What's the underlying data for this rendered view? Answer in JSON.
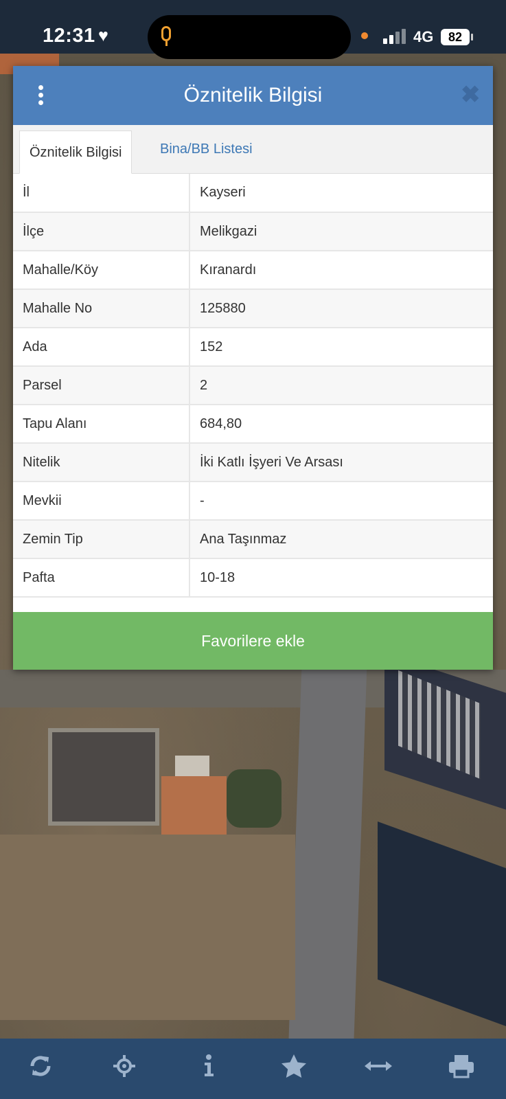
{
  "status_bar": {
    "time": "12:31",
    "network": "4G",
    "battery": "82"
  },
  "dialog": {
    "title": "Öznitelik Bilgisi",
    "tabs": [
      {
        "label": "Öznitelik Bilgisi",
        "active": true
      },
      {
        "label": "Bina/BB Listesi",
        "active": false
      }
    ],
    "rows": [
      {
        "key": "İl",
        "value": "Kayseri"
      },
      {
        "key": "İlçe",
        "value": "Melikgazi"
      },
      {
        "key": "Mahalle/Köy",
        "value": "Kıranardı"
      },
      {
        "key": "Mahalle No",
        "value": "125880"
      },
      {
        "key": "Ada",
        "value": "152"
      },
      {
        "key": "Parsel",
        "value": "2"
      },
      {
        "key": "Tapu Alanı",
        "value": "684,80"
      },
      {
        "key": "Nitelik",
        "value": "İki Katlı İşyeri Ve Arsası"
      },
      {
        "key": "Mevkii",
        "value": "-"
      },
      {
        "key": "Zemin Tip",
        "value": "Ana Taşınmaz"
      },
      {
        "key": "Pafta",
        "value": "10-18"
      }
    ],
    "favorite_button": "Favorilere ekle"
  },
  "toolbar": {
    "icons": [
      "refresh-icon",
      "locate-icon",
      "info-icon",
      "star-icon",
      "measure-icon",
      "print-icon"
    ]
  },
  "colors": {
    "header": "#4d80bc",
    "tab_link": "#3d78b5",
    "favorite_button": "#72b965",
    "toolbar": "#2a4a6e",
    "toolbar_icon": "#9db3cc"
  }
}
